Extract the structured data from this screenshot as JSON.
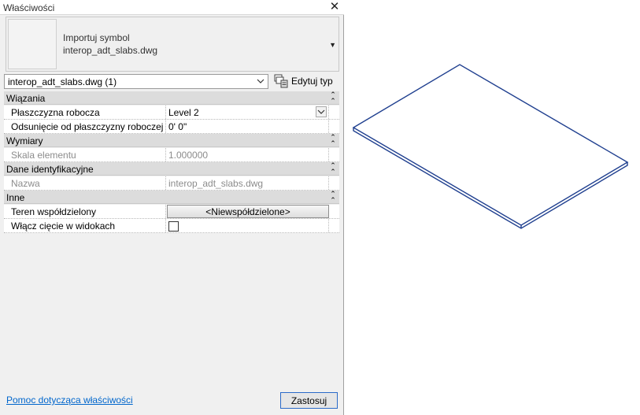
{
  "panel": {
    "title": "Właściwości",
    "type_box": {
      "family_label": "Importuj symbol",
      "type_name": "interop_adt_slabs.dwg"
    },
    "selector": {
      "value": "interop_adt_slabs.dwg (1)"
    },
    "edit_type_label": "Edytuj typ"
  },
  "groups": [
    {
      "title": "Wiązania",
      "rows": [
        {
          "name": "Płaszczyzna robocza",
          "value": "Level 2"
        },
        {
          "name": "Odsunięcie od płaszczyzny roboczej",
          "value": "0'  0\""
        }
      ]
    },
    {
      "title": "Wymiary",
      "rows": [
        {
          "name": "Skala elementu",
          "value": "1.000000"
        }
      ]
    },
    {
      "title": "Dane identyfikacyjne",
      "rows": [
        {
          "name": "Nazwa",
          "value": "interop_adt_slabs.dwg"
        }
      ]
    },
    {
      "title": "Inne",
      "rows": [
        {
          "name": "Teren współdzielony",
          "value": "<Niewspółdzielone>"
        },
        {
          "name": "Włącz cięcie w widokach",
          "value": false
        }
      ]
    }
  ],
  "footer": {
    "help_link": "Pomoc dotycząca właściwości",
    "apply_label": "Zastosuj"
  },
  "colors": {
    "slab_edge": "#1f3f8f",
    "link": "#0066cc"
  }
}
